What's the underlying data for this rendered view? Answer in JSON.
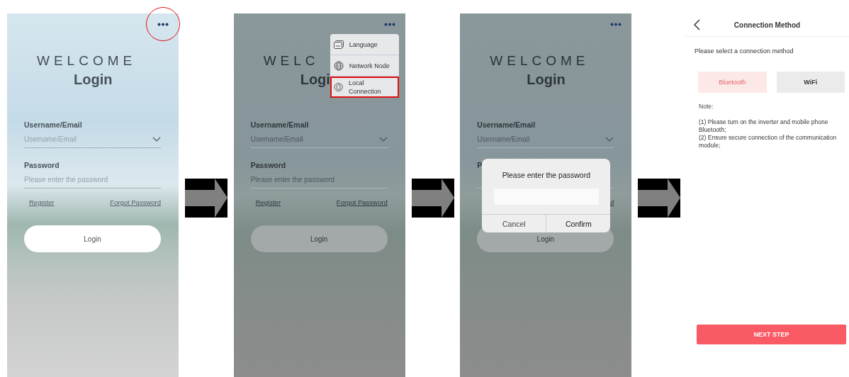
{
  "screens": [
    {
      "kind": "login",
      "dimmed": false,
      "more_circled": true,
      "welcome": "WELCOME",
      "title": "Login",
      "username_label": "Username/Email",
      "username_placeholder": "Username/Email",
      "password_label": "Password",
      "password_placeholder": "Please enter the password",
      "register": "Register",
      "forgot": "Forgot Password",
      "login_button": "Login"
    },
    {
      "kind": "login",
      "dimmed": true,
      "more_circled": false,
      "welcome": "WELC",
      "title": "Logi",
      "username_label": "Username/Email",
      "username_placeholder": "Username/Email",
      "password_label": "Password",
      "password_placeholder": "Please enter the password",
      "register": "Register",
      "forgot": "Forgot Password",
      "login_button": "Login",
      "menu": [
        {
          "label": "Language",
          "highlighted": false
        },
        {
          "label": "Network Node",
          "highlighted": false
        },
        {
          "label": "Local Connection",
          "highlighted": true
        }
      ]
    },
    {
      "kind": "login",
      "dimmed": true,
      "more_circled": false,
      "welcome": "WELCOME",
      "title": "Login",
      "username_label": "Username/Email",
      "username_placeholder": "Username/Email",
      "password_label": "P",
      "forgot": "d",
      "login_button": "Login",
      "dialog": {
        "title": "Please enter the password",
        "cancel": "Cancel",
        "confirm": "Confirm"
      }
    },
    {
      "kind": "connection",
      "title": "Connection Method",
      "prompt": "Please select a connection method",
      "options": [
        {
          "label": "Bluetooth",
          "selected": true
        },
        {
          "label": "WiFi",
          "selected": false
        }
      ],
      "note_title": "Note:",
      "notes": [
        " (1) Please turn on the inverter and mobile phone Bluetooth;",
        " (2) Ensure secure connection of the communication module;"
      ],
      "next_button": "NEXT STEP"
    }
  ]
}
